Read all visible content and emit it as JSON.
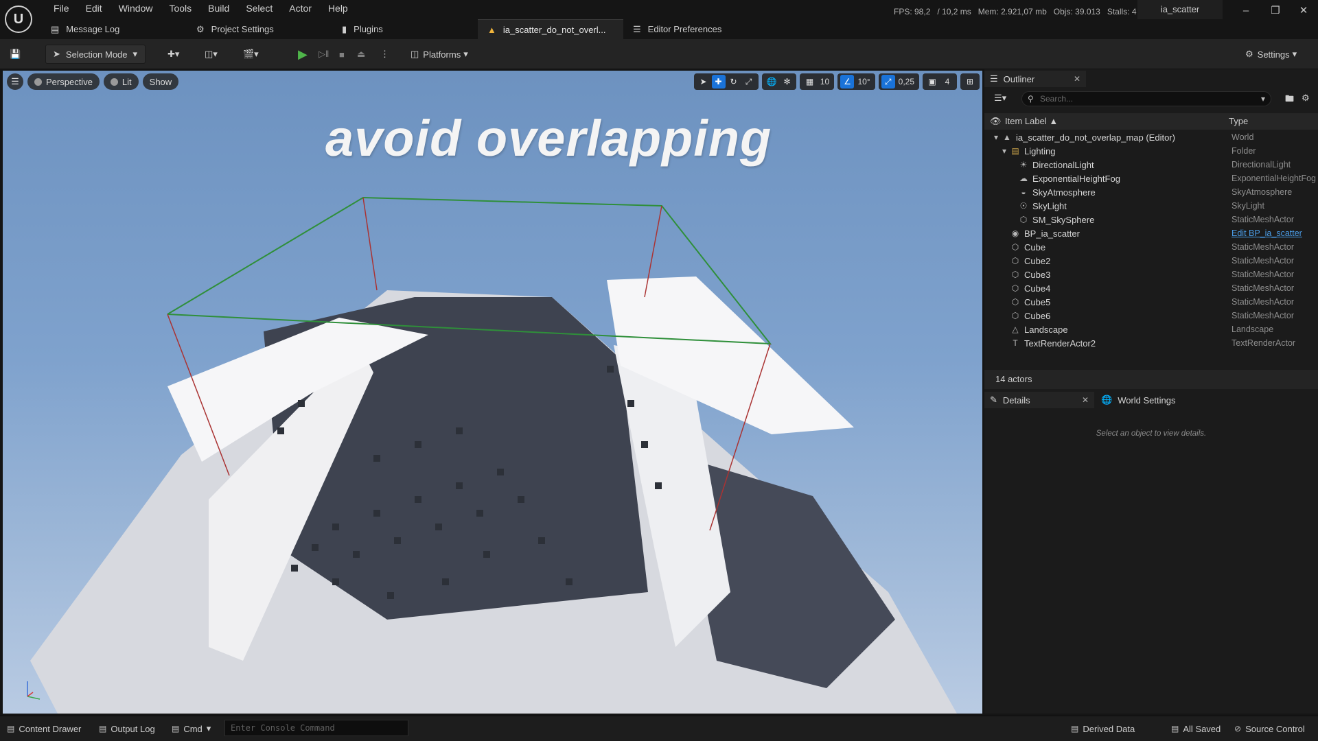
{
  "menu": [
    "File",
    "Edit",
    "Window",
    "Tools",
    "Build",
    "Select",
    "Actor",
    "Help"
  ],
  "stats": {
    "fps": "FPS: 98,2",
    "ms": "/ 10,2 ms",
    "mem": "Mem: 2.921,07 mb",
    "objs": "Objs: 39.013",
    "stalls": "Stalls: 4"
  },
  "project_name": "ia_scatter",
  "tabs": [
    {
      "label": "Message Log"
    },
    {
      "label": "Project Settings"
    },
    {
      "label": "Plugins"
    },
    {
      "label": "ia_scatter_do_not_overl..."
    },
    {
      "label": "Editor Preferences"
    }
  ],
  "toolbar": {
    "selection_mode": "Selection Mode",
    "platforms": "Platforms",
    "settings": "Settings"
  },
  "viewport": {
    "perspective": "Perspective",
    "lit": "Lit",
    "show": "Show",
    "grid_size": "10",
    "rot_snap": "10°",
    "scale_snap": "0,25",
    "cam_speed": "4",
    "scene_text": "avoid overlapping"
  },
  "outliner": {
    "tab": "Outliner",
    "search_placeholder": "Search...",
    "col_label": "Item Label ▲",
    "col_type": "Type",
    "rows": [
      {
        "label": "ia_scatter_do_not_overlap_map (Editor)",
        "type": "World",
        "indent": 1,
        "icon": "world-icon",
        "arrow": true
      },
      {
        "label": "Lighting",
        "type": "Folder",
        "indent": 2,
        "icon": "folder-icon",
        "arrow": true
      },
      {
        "label": "DirectionalLight",
        "type": "DirectionalLight",
        "indent": 3,
        "icon": "sun-icon"
      },
      {
        "label": "ExponentialHeightFog",
        "type": "ExponentialHeightFog",
        "indent": 3,
        "icon": "fog-icon"
      },
      {
        "label": "SkyAtmosphere",
        "type": "SkyAtmosphere",
        "indent": 3,
        "icon": "atmosphere-icon"
      },
      {
        "label": "SkyLight",
        "type": "SkyLight",
        "indent": 3,
        "icon": "skylight-icon"
      },
      {
        "label": "SM_SkySphere",
        "type": "StaticMeshActor",
        "indent": 3,
        "icon": "mesh-icon"
      },
      {
        "label": "BP_ia_scatter",
        "type": "Edit BP_ia_scatter",
        "indent": 2,
        "icon": "blueprint-icon",
        "link": true
      },
      {
        "label": "Cube",
        "type": "StaticMeshActor",
        "indent": 2,
        "icon": "mesh-icon"
      },
      {
        "label": "Cube2",
        "type": "StaticMeshActor",
        "indent": 2,
        "icon": "mesh-icon"
      },
      {
        "label": "Cube3",
        "type": "StaticMeshActor",
        "indent": 2,
        "icon": "mesh-icon"
      },
      {
        "label": "Cube4",
        "type": "StaticMeshActor",
        "indent": 2,
        "icon": "mesh-icon"
      },
      {
        "label": "Cube5",
        "type": "StaticMeshActor",
        "indent": 2,
        "icon": "mesh-icon"
      },
      {
        "label": "Cube6",
        "type": "StaticMeshActor",
        "indent": 2,
        "icon": "mesh-icon"
      },
      {
        "label": "Landscape",
        "type": "Landscape",
        "indent": 2,
        "icon": "landscape-icon"
      },
      {
        "label": "TextRenderActor2",
        "type": "TextRenderActor",
        "indent": 2,
        "icon": "text-icon"
      }
    ],
    "actors_count": "14 actors"
  },
  "details": {
    "tab": "Details",
    "world_settings": "World Settings",
    "hint": "Select an object to view details."
  },
  "statusbar": {
    "content_drawer": "Content Drawer",
    "output_log": "Output Log",
    "cmd": "Cmd",
    "console_placeholder": "Enter Console Command",
    "derived_data": "Derived Data",
    "all_saved": "All Saved",
    "source_control": "Source Control"
  },
  "colors": {
    "accent_blue": "#1a73d9",
    "play_green": "#4fb54a",
    "warning_orange": "#f0b43c"
  }
}
